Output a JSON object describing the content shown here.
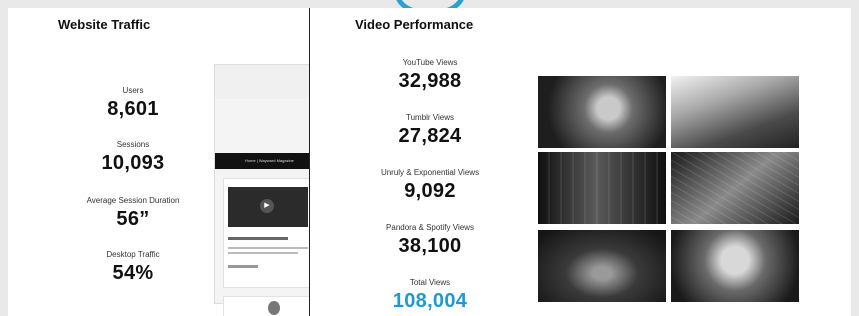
{
  "website_traffic": {
    "title": "Website Traffic",
    "stats": [
      {
        "label": "Users",
        "value": "8,601"
      },
      {
        "label": "Sessions",
        "value": "10,093"
      },
      {
        "label": "Average Session Duration",
        "value": "56”"
      },
      {
        "label": "Desktop Traffic",
        "value": "54%"
      }
    ],
    "site_preview": {
      "nav_text": "Home  |  Wayward Magazine"
    }
  },
  "video_performance": {
    "title": "Video Performance",
    "stats": [
      {
        "label": "YouTube Views",
        "value": "32,988"
      },
      {
        "label": "Tumblr Views",
        "value": "27,824"
      },
      {
        "label": "Unruly & Exponential Views",
        "value": "9,092"
      },
      {
        "label": "Pandora & Spotify Views",
        "value": "38,100"
      },
      {
        "label": "Total Views",
        "value": "108,004"
      }
    ]
  },
  "colors": {
    "accent": "#1e9ad2",
    "background": "#e9e9ea"
  },
  "icons": {
    "play": "play-icon"
  }
}
